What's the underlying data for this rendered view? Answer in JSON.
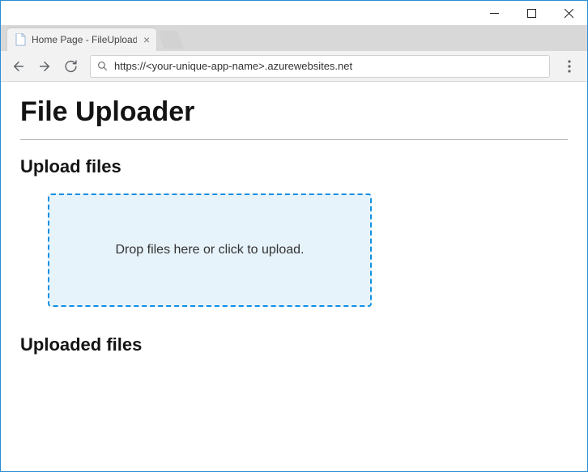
{
  "browser": {
    "tab_title": "Home Page - FileUploade",
    "address": "https://<your-unique-app-name>.azurewebsites.net"
  },
  "page": {
    "title": "File Uploader",
    "upload_heading": "Upload files",
    "dropzone_text": "Drop files here or click to upload.",
    "uploaded_heading": "Uploaded files"
  }
}
